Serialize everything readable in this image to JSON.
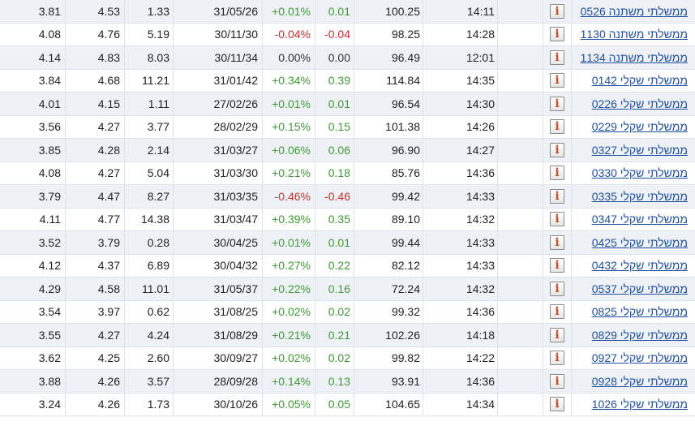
{
  "colors": {
    "positive": "#3f9a36",
    "negative": "#c9302c",
    "link": "#1f4f9a",
    "row_alt": "#eef2f7",
    "info_icon": "#d24a1a"
  },
  "info_icon_glyph": "i",
  "rows": [
    {
      "c1": "3.81",
      "c2": "4.53",
      "c3": "1.33",
      "date": "31/05/26",
      "pct": "+0.01%",
      "chg": "0.01",
      "dir": "pos",
      "price": "100.25",
      "time": "14:11",
      "name": "ממשלתי משתנה 0526"
    },
    {
      "c1": "4.08",
      "c2": "4.76",
      "c3": "5.19",
      "date": "30/11/30",
      "pct": "-0.04%",
      "chg": "-0.04",
      "dir": "neg",
      "price": "98.25",
      "time": "14:28",
      "name": "ממשלתי משתנה 1130"
    },
    {
      "c1": "4.14",
      "c2": "4.83",
      "c3": "8.03",
      "date": "30/11/34",
      "pct": "0.00%",
      "chg": "0.00",
      "dir": "neu",
      "price": "96.49",
      "time": "12:01",
      "name": "ממשלתי משתנה 1134"
    },
    {
      "c1": "3.84",
      "c2": "4.68",
      "c3": "11.21",
      "date": "31/01/42",
      "pct": "+0.34%",
      "chg": "0.39",
      "dir": "pos",
      "price": "114.84",
      "time": "14:35",
      "name": "ממשלתי שקלי 0142"
    },
    {
      "c1": "4.01",
      "c2": "4.15",
      "c3": "1.11",
      "date": "27/02/26",
      "pct": "+0.01%",
      "chg": "0.01",
      "dir": "pos",
      "price": "96.54",
      "time": "14:30",
      "name": "ממשלתי שקלי 0226"
    },
    {
      "c1": "3.56",
      "c2": "4.27",
      "c3": "3.77",
      "date": "28/02/29",
      "pct": "+0.15%",
      "chg": "0.15",
      "dir": "pos",
      "price": "101.38",
      "time": "14:26",
      "name": "ממשלתי שקלי 0229"
    },
    {
      "c1": "3.85",
      "c2": "4.28",
      "c3": "2.14",
      "date": "31/03/27",
      "pct": "+0.06%",
      "chg": "0.06",
      "dir": "pos",
      "price": "96.90",
      "time": "14:27",
      "name": "ממשלתי שקלי 0327"
    },
    {
      "c1": "4.08",
      "c2": "4.27",
      "c3": "5.04",
      "date": "31/03/30",
      "pct": "+0.21%",
      "chg": "0.18",
      "dir": "pos",
      "price": "85.76",
      "time": "14:36",
      "name": "ממשלתי שקלי 0330"
    },
    {
      "c1": "3.79",
      "c2": "4.47",
      "c3": "8.27",
      "date": "31/03/35",
      "pct": "-0.46%",
      "chg": "-0.46",
      "dir": "neg",
      "price": "99.42",
      "time": "14:33",
      "name": "ממשלתי שקלי 0335"
    },
    {
      "c1": "4.11",
      "c2": "4.77",
      "c3": "14.38",
      "date": "31/03/47",
      "pct": "+0.39%",
      "chg": "0.35",
      "dir": "pos",
      "price": "89.10",
      "time": "14:32",
      "name": "ממשלתי שקלי 0347"
    },
    {
      "c1": "3.52",
      "c2": "3.79",
      "c3": "0.28",
      "date": "30/04/25",
      "pct": "+0.01%",
      "chg": "0.01",
      "dir": "pos",
      "price": "99.44",
      "time": "14:33",
      "name": "ממשלתי שקלי 0425"
    },
    {
      "c1": "4.12",
      "c2": "4.37",
      "c3": "6.89",
      "date": "30/04/32",
      "pct": "+0.27%",
      "chg": "0.22",
      "dir": "pos",
      "price": "82.12",
      "time": "14:33",
      "name": "ממשלתי שקלי 0432"
    },
    {
      "c1": "4.29",
      "c2": "4.58",
      "c3": "11.01",
      "date": "31/05/37",
      "pct": "+0.22%",
      "chg": "0.16",
      "dir": "pos",
      "price": "72.24",
      "time": "14:32",
      "name": "ממשלתי שקלי 0537"
    },
    {
      "c1": "3.54",
      "c2": "3.97",
      "c3": "0.62",
      "date": "31/08/25",
      "pct": "+0.02%",
      "chg": "0.02",
      "dir": "pos",
      "price": "99.32",
      "time": "14:36",
      "name": "ממשלתי שקלי 0825"
    },
    {
      "c1": "3.55",
      "c2": "4.27",
      "c3": "4.24",
      "date": "31/08/29",
      "pct": "+0.21%",
      "chg": "0.21",
      "dir": "pos",
      "price": "102.26",
      "time": "14:18",
      "name": "ממשלתי שקלי 0829"
    },
    {
      "c1": "3.62",
      "c2": "4.25",
      "c3": "2.60",
      "date": "30/09/27",
      "pct": "+0.02%",
      "chg": "0.02",
      "dir": "pos",
      "price": "99.82",
      "time": "14:22",
      "name": "ממשלתי שקלי 0927"
    },
    {
      "c1": "3.88",
      "c2": "4.26",
      "c3": "3.57",
      "date": "28/09/28",
      "pct": "+0.14%",
      "chg": "0.13",
      "dir": "pos",
      "price": "93.91",
      "time": "14:36",
      "name": "ממשלתי שקלי 0928"
    },
    {
      "c1": "3.24",
      "c2": "4.26",
      "c3": "1.73",
      "date": "30/10/26",
      "pct": "+0.05%",
      "chg": "0.05",
      "dir": "pos",
      "price": "104.65",
      "time": "14:34",
      "name": "ממשלתי שקלי 1026"
    }
  ]
}
